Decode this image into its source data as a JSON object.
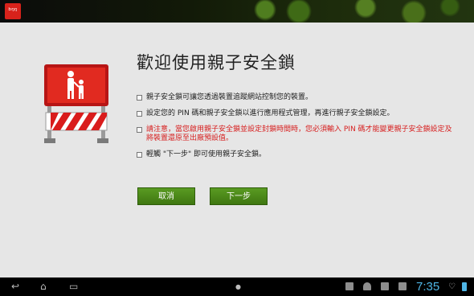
{
  "app": {
    "title": "歡迎使用親子安全鎖",
    "icon": "parental-lock-app-icon",
    "icon_glyph": "ᵇᵑᵑ"
  },
  "items": [
    {
      "text": "親子安全鎖可讓您透過裝置追蹤網站控制您的裝置。",
      "color": "#222222"
    },
    {
      "text": "設定您的 PIN 碼和親子安全鎖以進行應用程式管理，再進行親子安全鎖設定。",
      "color": "#222222"
    },
    {
      "text": "請注意，當您啟用親子安全鎖並設定封鎖時間時，您必須輸入 PIN 碼才能變更親子安全鎖設定及將裝置還原至出廠預設值。",
      "color": "#d71f1f"
    },
    {
      "text": "輕觸 \"下一步\" 即可使用親子安全鎖。",
      "color": "#222222"
    }
  ],
  "buttons": {
    "cancel": "取消",
    "next": "下一步"
  },
  "navbar": {
    "clock": "7:35",
    "icons": [
      "back-icon",
      "home-icon",
      "recent-apps-icon"
    ],
    "tray_icons": [
      "image-icon",
      "android-icon",
      "play-store-icon",
      "media-icon",
      "wifi-icon",
      "battery-icon"
    ],
    "back_glyph": "↩",
    "home_glyph": "⌂",
    "recent_glyph": "▭"
  },
  "colors": {
    "accent_green": "#4a8a18",
    "warning_red": "#d71f1f",
    "clock_blue": "#4fb6e6"
  }
}
